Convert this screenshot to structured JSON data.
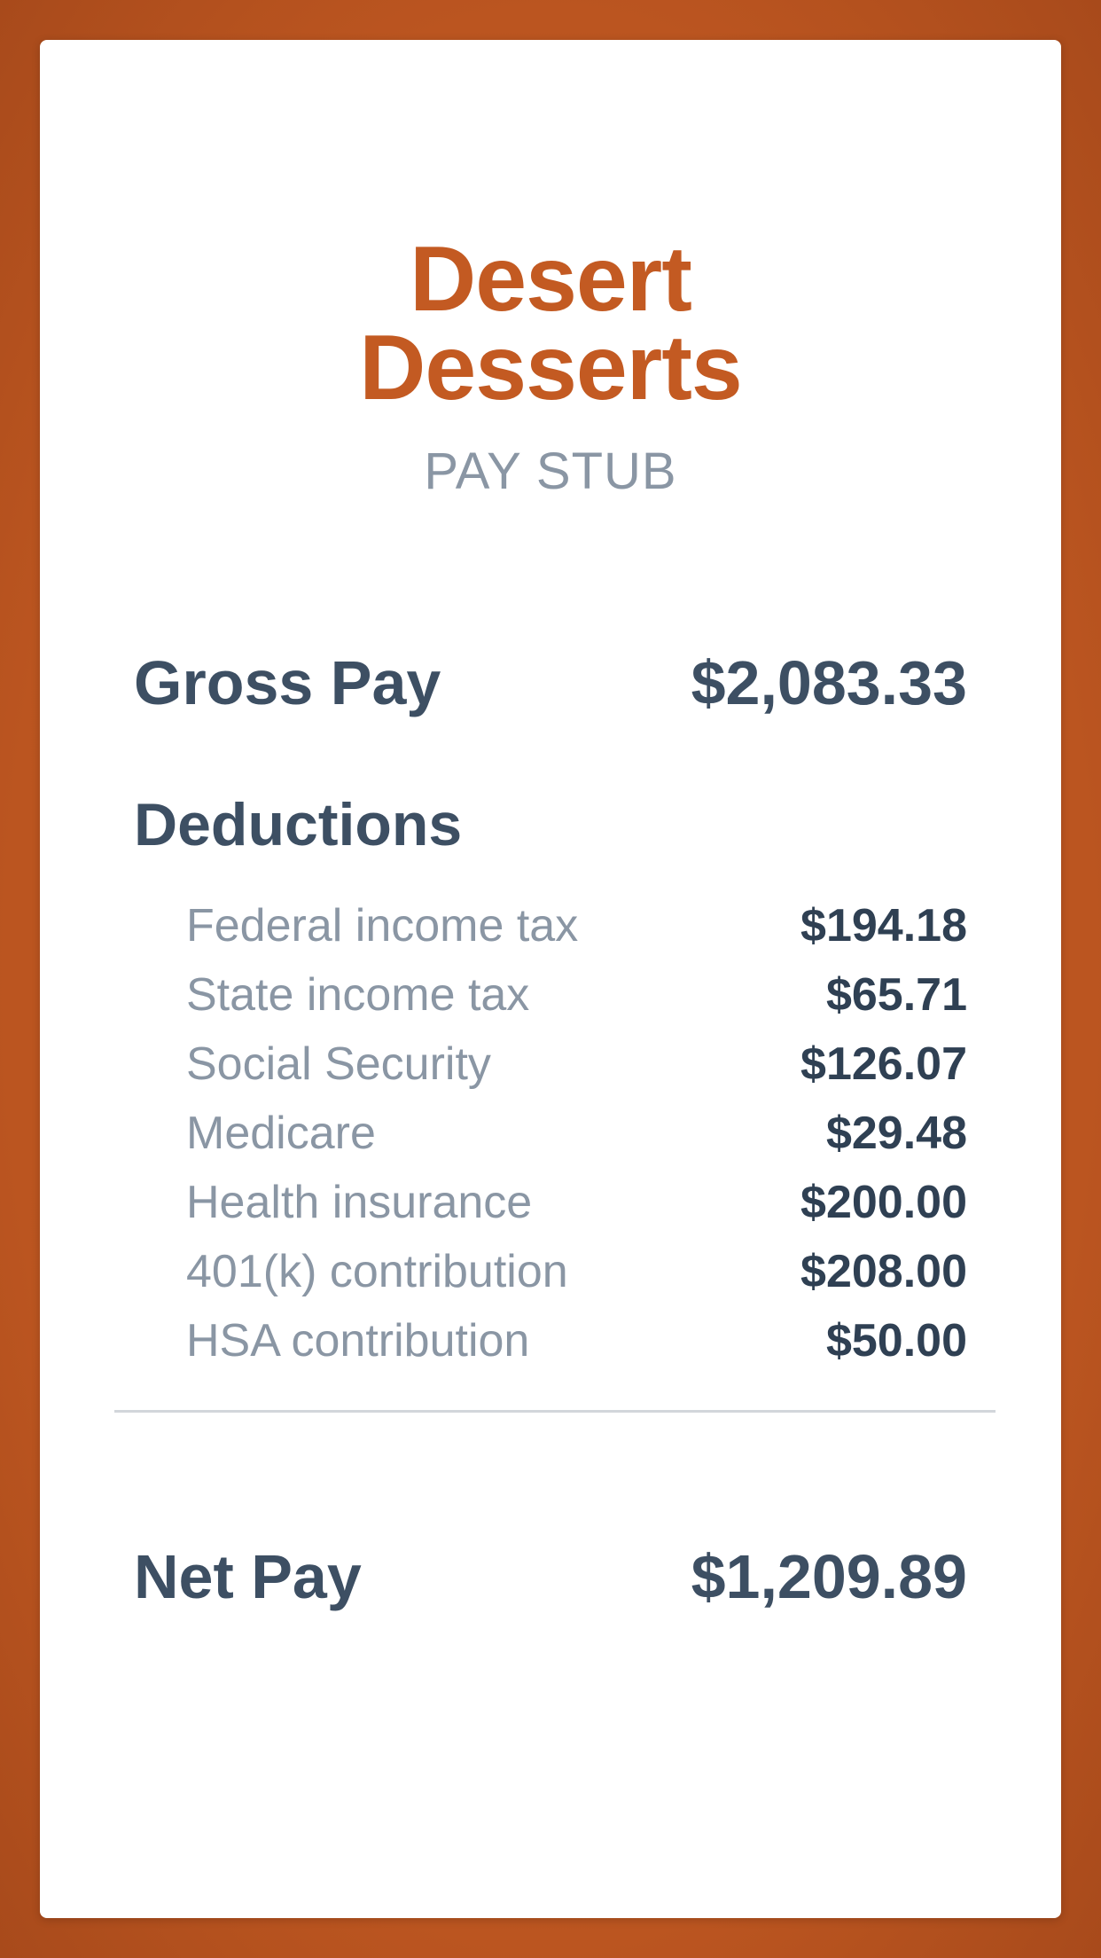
{
  "header": {
    "company_line1": "Desert",
    "company_line2": "Desserts",
    "subtitle": "PAY STUB"
  },
  "gross_pay": {
    "label": "Gross Pay",
    "amount": "$2,083.33"
  },
  "deductions": {
    "heading": "Deductions",
    "items": [
      {
        "label": "Federal income tax",
        "amount": "$194.18"
      },
      {
        "label": "State income tax",
        "amount": "$65.71"
      },
      {
        "label": "Social Security",
        "amount": "$126.07"
      },
      {
        "label": "Medicare",
        "amount": "$29.48"
      },
      {
        "label": "Health insurance",
        "amount": "$200.00"
      },
      {
        "label": "401(k) contribution",
        "amount": "$208.00"
      },
      {
        "label": "HSA contribution",
        "amount": "$50.00"
      }
    ]
  },
  "net_pay": {
    "label": "Net Pay",
    "amount": "$1,209.89"
  },
  "colors": {
    "background": "#bb5520",
    "brand": "#c35a22",
    "text_dark": "#3d4f63",
    "text_muted": "#8a96a4"
  }
}
